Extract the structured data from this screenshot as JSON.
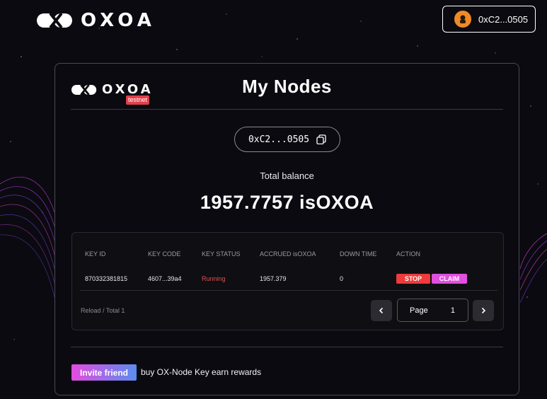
{
  "app": {
    "brand": "OXOA"
  },
  "header": {
    "wallet_address": "0xC2...0505"
  },
  "panel": {
    "brand": "OXOA",
    "badge": "testnet",
    "title": "My Nodes",
    "address": "0xC2...0505",
    "total_label": "Total balance",
    "total_value": "1957.7757 isOXOA"
  },
  "table": {
    "columns": [
      "KEY ID",
      "KEY CODE",
      "KEY STATUS",
      "ACCRUED isOXOA",
      "DOWN TIME",
      "ACTION"
    ],
    "rows": [
      {
        "key_id": "870332381815",
        "key_code": "4607...39a4",
        "status": "Running",
        "accrued": "1957.379",
        "down_time": "0",
        "stop_label": "STOP",
        "claim_label": "CLAIM"
      }
    ],
    "footer_info": "Reload / Total 1",
    "page_label": "Page",
    "page_number": "1"
  },
  "invite": {
    "button_label": "Invite friend",
    "text": "buy OX-Node Key earn rewards"
  },
  "colors": {
    "accent_red": "#ef3b3b",
    "accent_pink": "#e24ee0",
    "status_running": "#e05050",
    "badge": "#e0404a"
  },
  "icons": [
    "oxoa-logo-icon",
    "avatar-icon",
    "copy-icon",
    "chevron-left-icon",
    "chevron-right-icon"
  ]
}
